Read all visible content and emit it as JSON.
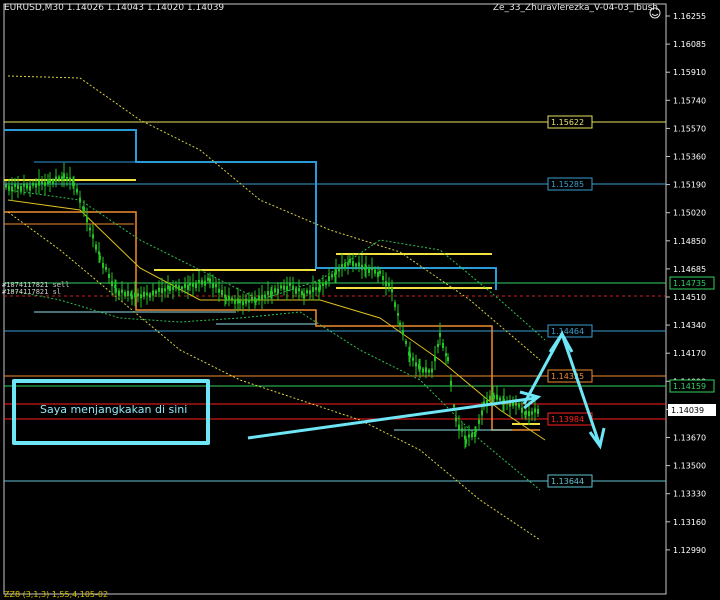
{
  "window": {
    "title": "EURUSD,M30  1.14026 1.14043 1.14020 1.14039",
    "indicator_label": "Ze_33_Zhuravlerezka_V-04-03_Ibush",
    "footer": "ZZ8 (3,1,3) 1,55,4,105-02"
  },
  "annotation": {
    "text": "Saya menjangkakan di sini"
  },
  "orders": [
    "#1874117821 sell",
    "#1874117821 sl"
  ],
  "price_axis": {
    "ticks": [
      "1.16255",
      "1.16085",
      "1.15910",
      "1.15740",
      "1.15570",
      "1.15360",
      "1.15190",
      "1.15020",
      "1.14850",
      "1.14685",
      "1.14510",
      "1.14340",
      "1.14170",
      "1.14000",
      "1.13840",
      "1.13670",
      "1.13500",
      "1.13330",
      "1.13160",
      "1.12990"
    ],
    "current_price": "1.14039"
  },
  "levels": [
    {
      "label": "1.15622",
      "color": "#e8e060"
    },
    {
      "label": "1.15285",
      "color": "#3aa0d0"
    },
    {
      "label": "1.14735",
      "color": "#30d060"
    },
    {
      "label": "1.14464",
      "color": "#3aa0d0"
    },
    {
      "label": "1.14325",
      "color": "#f08c30"
    },
    {
      "label": "1.14159",
      "color": "#30d060"
    },
    {
      "label": "1.13984",
      "color": "#ff2020"
    },
    {
      "label": "1.13644",
      "color": "#60c0d0"
    }
  ],
  "colors": {
    "background": "#000000",
    "candles": "#22c422",
    "axis_text": "#ffffff",
    "arrow": "#6ee6f6"
  }
}
